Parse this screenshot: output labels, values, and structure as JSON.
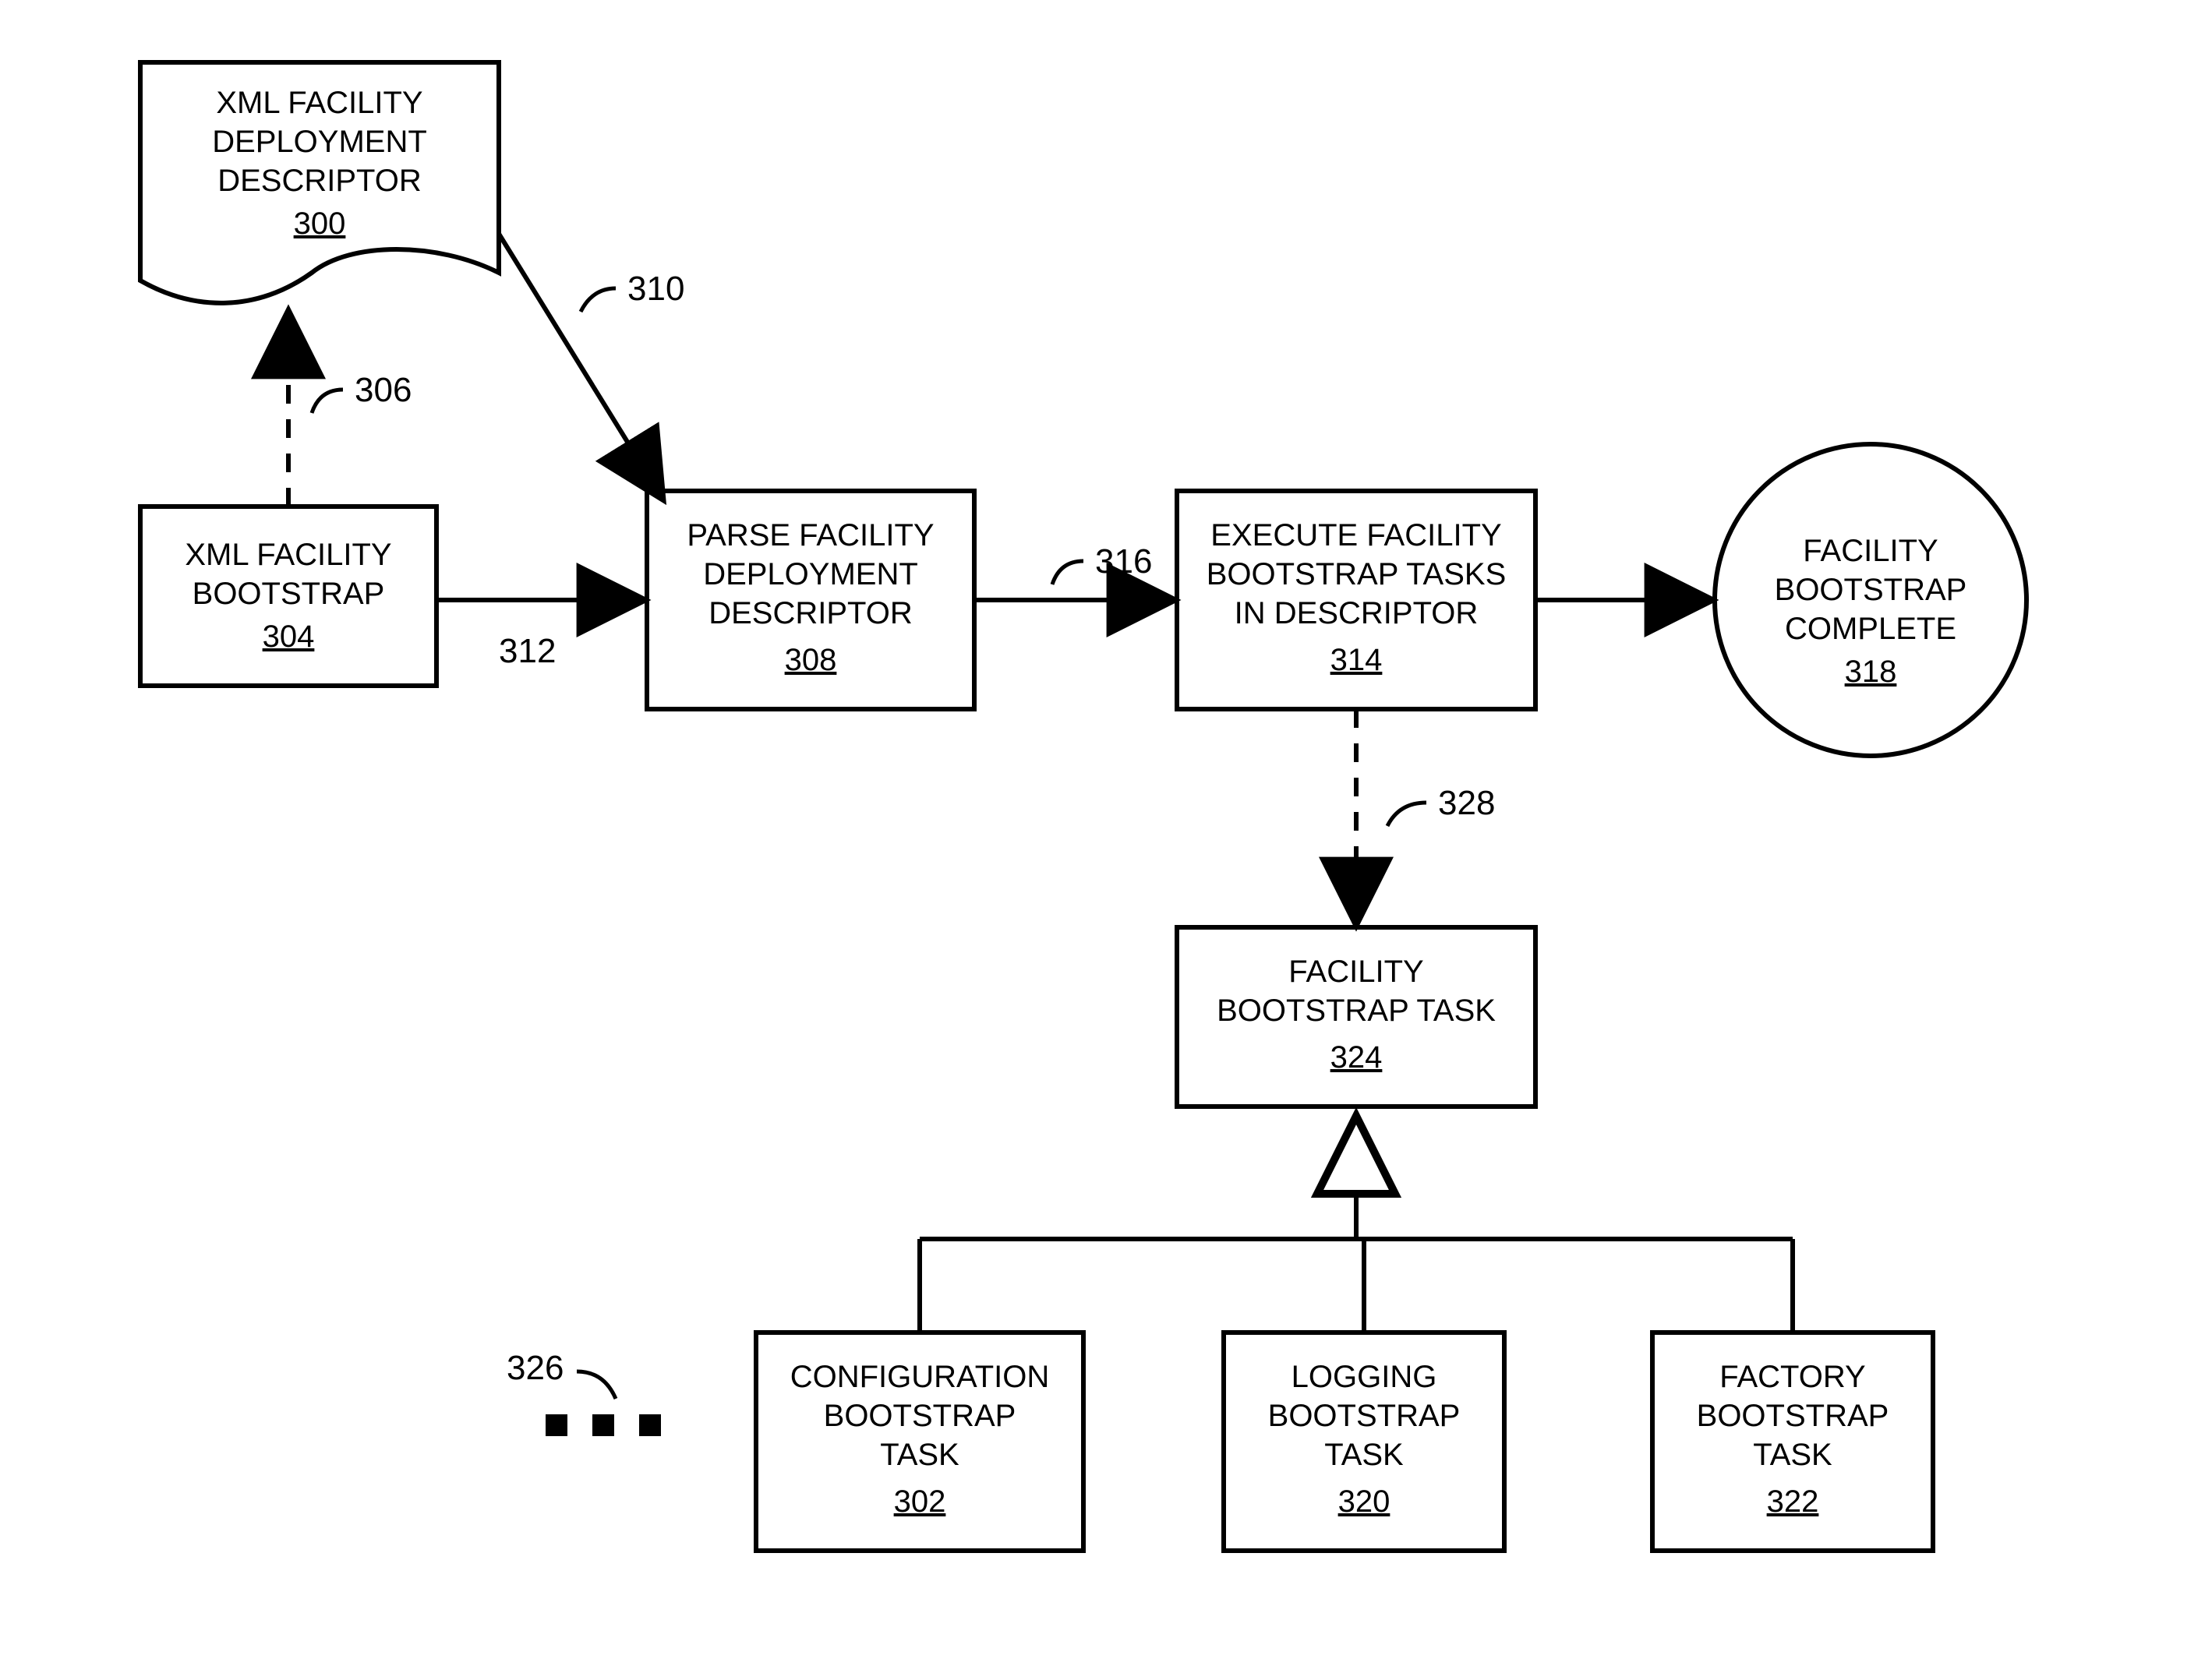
{
  "nodes": {
    "n300": {
      "l1": "XML FACILITY",
      "l2": "DEPLOYMENT",
      "l3": "DESCRIPTOR",
      "ref": "300"
    },
    "n304": {
      "l1": "XML FACILITY",
      "l2": "BOOTSTRAP",
      "ref": "304"
    },
    "n308": {
      "l1": "PARSE FACILITY",
      "l2": "DEPLOYMENT",
      "l3": "DESCRIPTOR",
      "ref": "308"
    },
    "n314": {
      "l1": "EXECUTE FACILITY",
      "l2": "BOOTSTRAP TASKS",
      "l3": "IN DESCRIPTOR",
      "ref": "314"
    },
    "n318": {
      "l1": "FACILITY",
      "l2": "BOOTSTRAP",
      "l3": "COMPLETE",
      "ref": "318"
    },
    "n324": {
      "l1": "FACILITY",
      "l2": "BOOTSTRAP TASK",
      "ref": "324"
    },
    "n302": {
      "l1": "CONFIGURATION",
      "l2": "BOOTSTRAP",
      "l3": "TASK",
      "ref": "302"
    },
    "n320": {
      "l1": "LOGGING",
      "l2": "BOOTSTRAP",
      "l3": "TASK",
      "ref": "320"
    },
    "n322": {
      "l1": "FACTORY",
      "l2": "BOOTSTRAP",
      "l3": "TASK",
      "ref": "322"
    }
  },
  "labels": {
    "l306": "306",
    "l310": "310",
    "l312": "312",
    "l316": "316",
    "l328": "328",
    "l326": "326"
  },
  "ellipsis": ". . ."
}
